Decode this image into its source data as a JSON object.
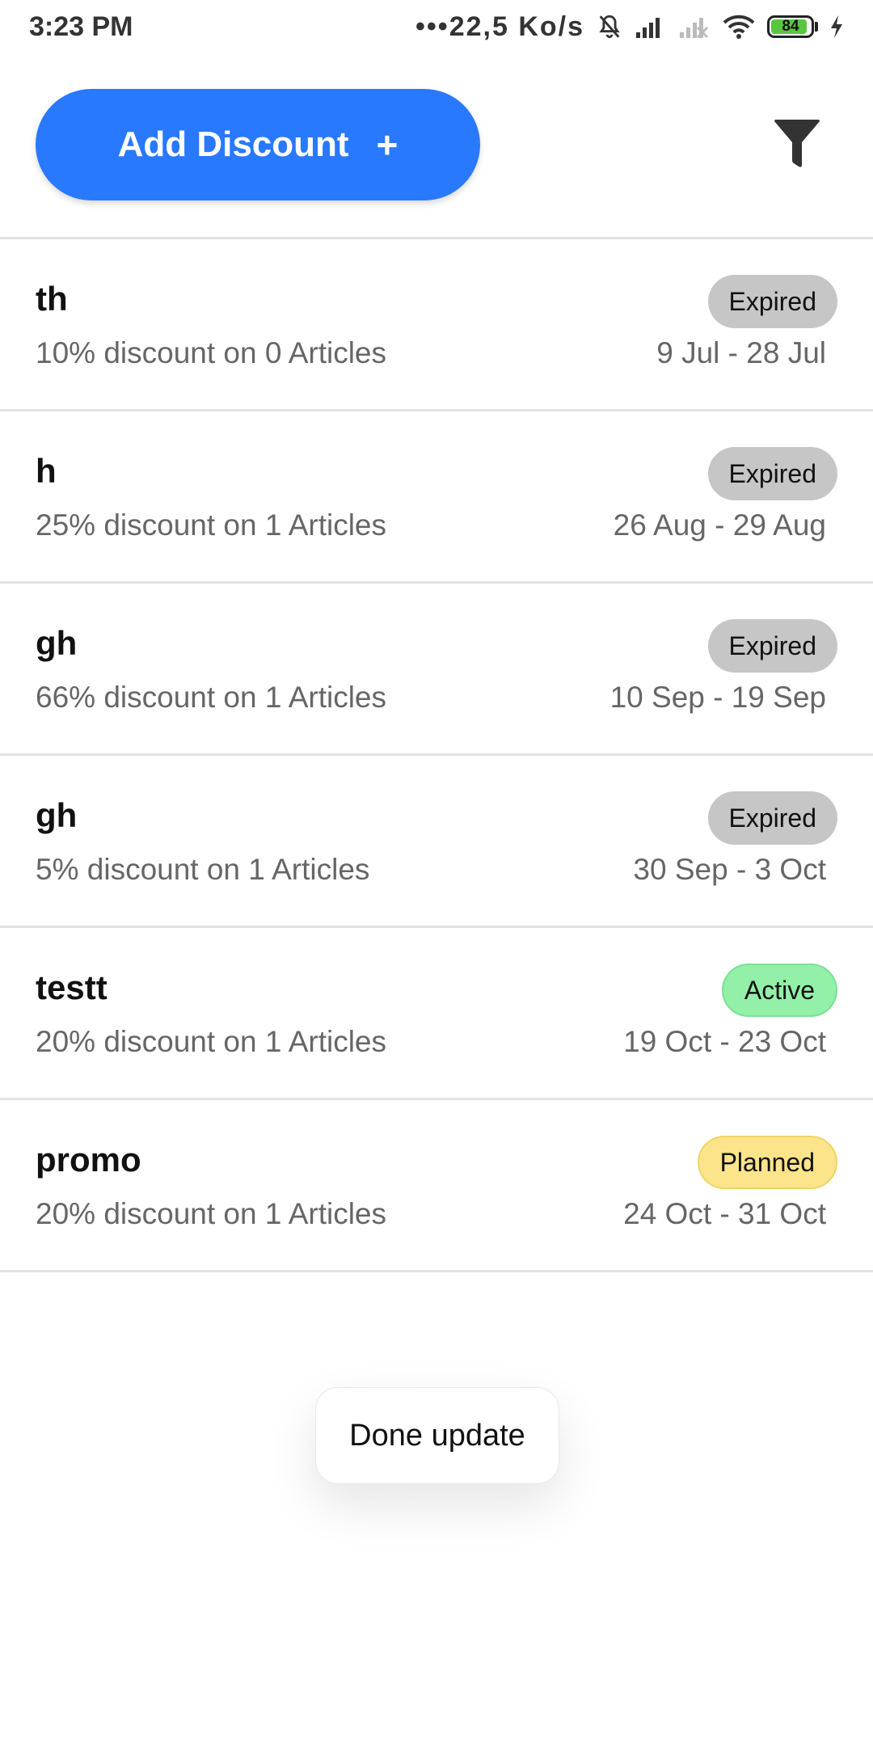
{
  "status_bar": {
    "time": "3:23 PM",
    "network_speed": "•••22,5 Ko/s",
    "battery_level": "84",
    "icons": [
      "bell-off-icon",
      "signal-icon",
      "signal-weak-icon",
      "wifi-icon",
      "battery-icon",
      "charging-icon"
    ]
  },
  "header": {
    "add_button_label": "Add Discount",
    "add_button_plus": "+",
    "filter_icon": "filter-icon",
    "accent_color": "#2979ff"
  },
  "discounts": [
    {
      "name": "th",
      "percent": "10%",
      "text1": "discount on",
      "count": "0",
      "text2": "Articles",
      "dates": "9 Jul - 28 Jul",
      "status": "Expired"
    },
    {
      "name": "h",
      "percent": "25%",
      "text1": "discount on",
      "count": "1",
      "text2": "Articles",
      "dates": "26 Aug - 29 Aug",
      "status": "Expired"
    },
    {
      "name": "gh",
      "percent": "66%",
      "text1": "discount on",
      "count": "1",
      "text2": "Articles",
      "dates": "10 Sep - 19 Sep",
      "status": "Expired"
    },
    {
      "name": "gh",
      "percent": "5%",
      "text1": "discount on",
      "count": "1",
      "text2": "Articles",
      "dates": "30 Sep - 3 Oct",
      "status": "Expired"
    },
    {
      "name": "testt",
      "percent": "20%",
      "text1": "discount on",
      "count": "1",
      "text2": "Articles",
      "dates": "19 Oct - 23 Oct",
      "status": "Active"
    },
    {
      "name": "promo",
      "percent": "20%",
      "text1": "discount on",
      "count": "1",
      "text2": "Articles",
      "dates": "24 Oct - 31 Oct",
      "status": "Planned"
    }
  ],
  "status_colors": {
    "Expired": "#c6c6c6",
    "Active": "#93f0a8",
    "Planned": "#fbe48a"
  },
  "toast": {
    "message": "Done update"
  }
}
